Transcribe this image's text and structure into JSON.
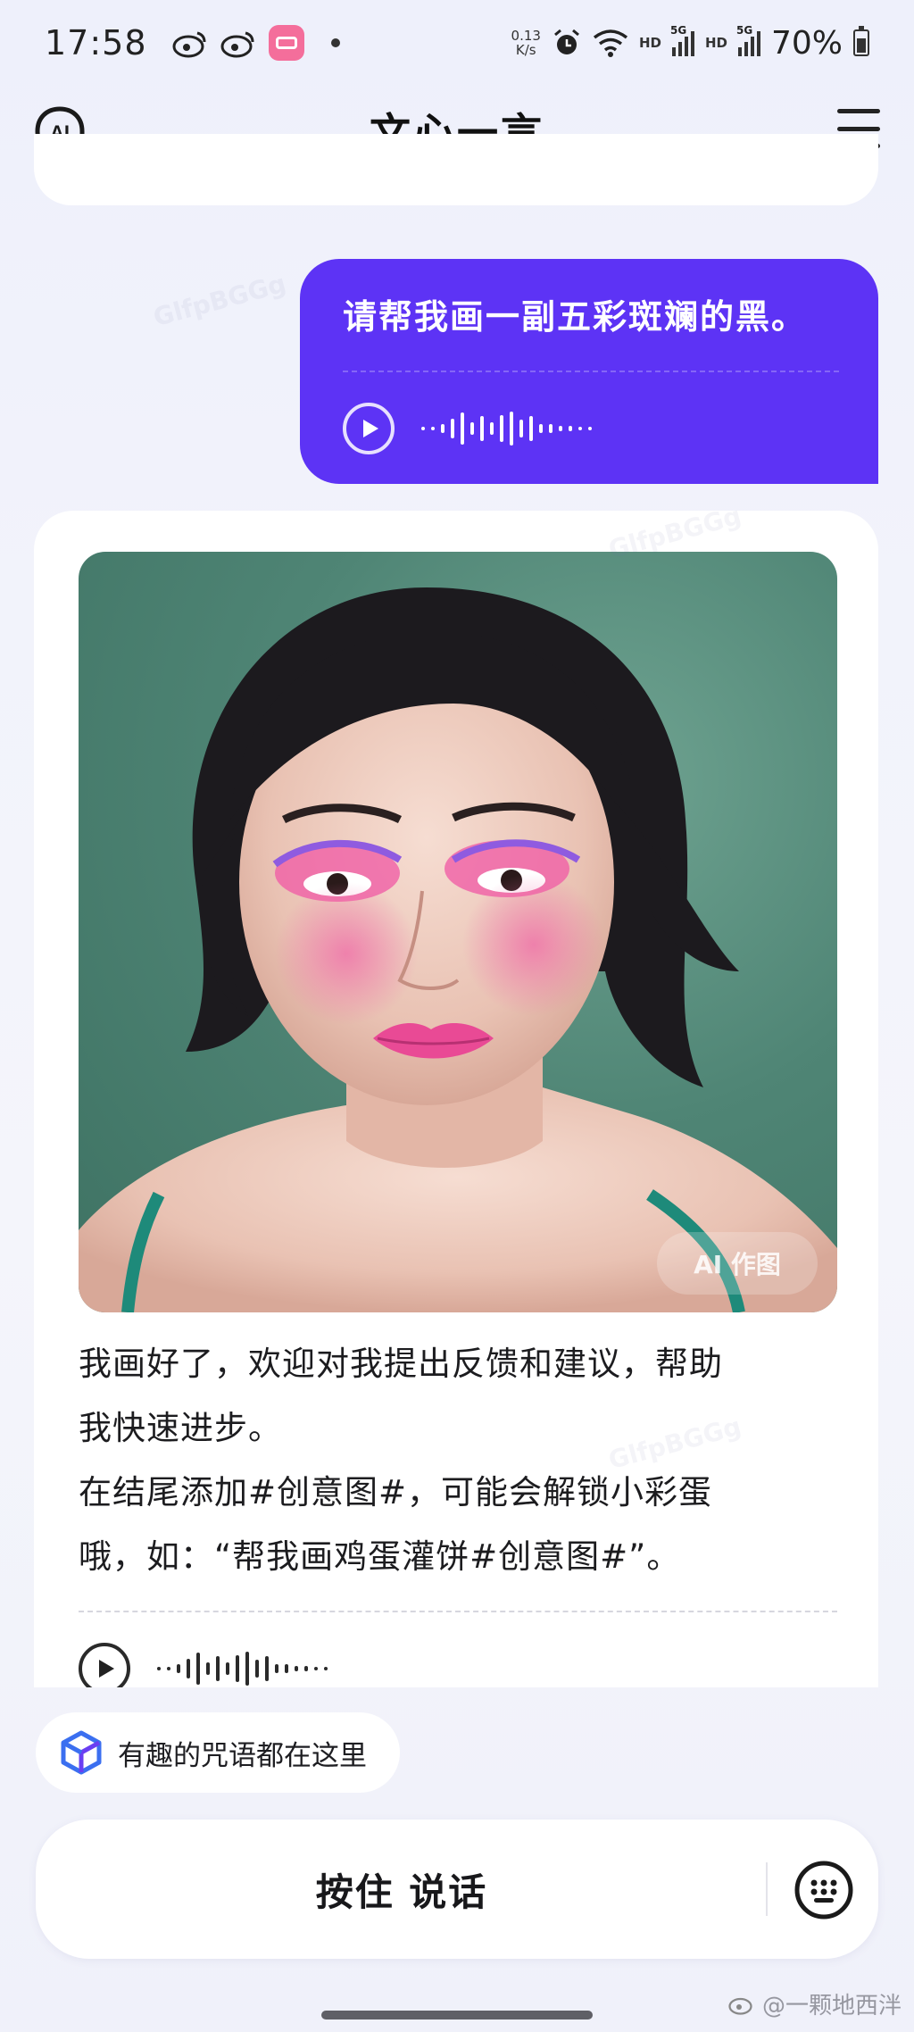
{
  "status_bar": {
    "time": "17:58",
    "net_speed_top": "0.13",
    "net_speed_unit": "K/s",
    "hd1": "HD",
    "hd2": "HD",
    "tag_5g_1": "5G",
    "tag_5g_2": "5G",
    "battery": "70%"
  },
  "header": {
    "title": "文心一言",
    "logo_text": "AI"
  },
  "user_message": {
    "text": "请帮我画一副五彩斑斓的黑。"
  },
  "ai_message": {
    "image_badge": "AI 作图",
    "lines": [
      "我画好了，欢迎对我提出反馈和建议，帮助",
      "我快速进步。",
      "在结尾添加#创意图#，可能会解锁小彩蛋",
      "哦，如：“帮我画鸡蛋灌饼#创意图#”。"
    ]
  },
  "tip_chip": {
    "label": "有趣的咒语都在这里"
  },
  "input_bar": {
    "hold_to_talk": "按住 说话"
  },
  "watermark": {
    "text": "@一颗地西泮",
    "overlay": "GlfpBGGg"
  },
  "colors": {
    "user_bubble": "#5d33f5",
    "background": "#f2f3fb",
    "card": "#ffffff"
  }
}
